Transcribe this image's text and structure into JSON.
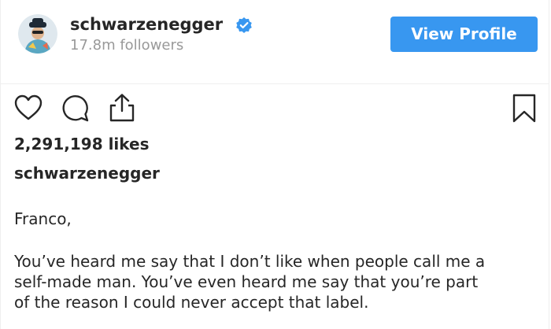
{
  "header": {
    "username": "schwarzenegger",
    "followers": "17.8m followers",
    "view_profile_label": "View Profile",
    "verified_icon": "verified-badge-icon"
  },
  "actions": {
    "like_icon": "heart-icon",
    "comment_icon": "comment-icon",
    "share_icon": "share-icon",
    "save_icon": "bookmark-icon"
  },
  "post": {
    "likes": "2,291,198 likes",
    "caption_username": "schwarzenegger",
    "caption_lines": [
      "Franco,",
      "You’ve heard me say that I don’t like when people call me a",
      "self-made man. You’ve even heard me say that you’re part",
      "of the reason I could never accept that label."
    ]
  },
  "colors": {
    "accent": "#3897f0",
    "text": "#262626",
    "muted": "#999999",
    "divider": "#efefef"
  }
}
